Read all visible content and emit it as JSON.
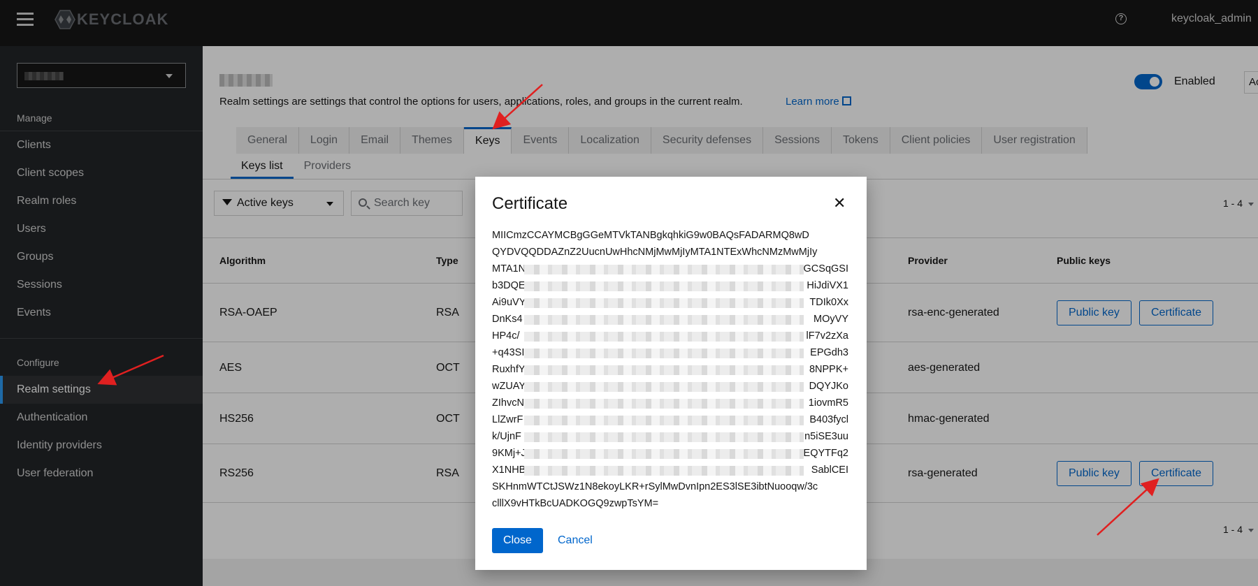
{
  "masthead": {
    "brand": "KEYCLOAK",
    "help": "?",
    "user": "keycloak_admin"
  },
  "sidebar": {
    "manage_label": "Manage",
    "manage_items": [
      {
        "label": "Clients"
      },
      {
        "label": "Client scopes"
      },
      {
        "label": "Realm roles"
      },
      {
        "label": "Users"
      },
      {
        "label": "Groups"
      },
      {
        "label": "Sessions"
      },
      {
        "label": "Events"
      }
    ],
    "configure_label": "Configure",
    "configure_items": [
      {
        "label": "Realm settings",
        "active": true
      },
      {
        "label": "Authentication"
      },
      {
        "label": "Identity providers"
      },
      {
        "label": "User federation"
      }
    ]
  },
  "header": {
    "description": "Realm settings are settings that control the options for users, applications, roles, and groups in the current realm.",
    "learn_more": "Learn more",
    "enabled_label": "Enabled",
    "enabled": true,
    "action_label": "Action"
  },
  "tabs": [
    {
      "label": "General"
    },
    {
      "label": "Login"
    },
    {
      "label": "Email"
    },
    {
      "label": "Themes"
    },
    {
      "label": "Keys",
      "active": true
    },
    {
      "label": "Events"
    },
    {
      "label": "Localization"
    },
    {
      "label": "Security defenses"
    },
    {
      "label": "Sessions"
    },
    {
      "label": "Tokens"
    },
    {
      "label": "Client policies"
    },
    {
      "label": "User registration"
    }
  ],
  "subtabs": [
    {
      "label": "Keys list",
      "active": true
    },
    {
      "label": "Providers"
    }
  ],
  "toolbar": {
    "filter": "Active keys",
    "search_placeholder": "Search key",
    "pagination": "1 - 4"
  },
  "table": {
    "headers": [
      "Algorithm",
      "Type",
      "Provider",
      "Public keys"
    ],
    "rows": [
      {
        "algorithm": "RSA-OAEP",
        "type": "RSA",
        "provider": "rsa-enc-generated",
        "public_key_btn": "Public key",
        "cert_btn": "Certificate"
      },
      {
        "algorithm": "AES",
        "type": "OCT",
        "provider": "aes-generated"
      },
      {
        "algorithm": "HS256",
        "type": "OCT",
        "provider": "hmac-generated"
      },
      {
        "algorithm": "RS256",
        "type": "RSA",
        "provider": "rsa-generated",
        "public_key_btn": "Public key",
        "cert_btn": "Certificate"
      }
    ]
  },
  "modal": {
    "title": "Certificate",
    "close_icon": "close-icon",
    "lines": [
      {
        "text": "MIICmzCCAYMCBgGGeMTVkTANBgkqhkiG9w0BAQsFADARMQ8wD"
      },
      {
        "text": "QYDVQQDDAZnZ2UucnUwHhcNMjMwMjIyMTA1NTExWhcNMzMwMjIy"
      },
      {
        "left": "MTA1N",
        "right": "GCSqGSI"
      },
      {
        "left": "b3DQE",
        "right": "HiJdiVX1"
      },
      {
        "left": "Ai9uVY",
        "right": "TDIk0Xx"
      },
      {
        "left": "DnKs4",
        "right": "MOyVY"
      },
      {
        "left": "HP4c/",
        "right": "lF7v2zXa"
      },
      {
        "left": "+q43SI",
        "right": "EPGdh3"
      },
      {
        "left": "RuxhfY",
        "right": "8NPPK+"
      },
      {
        "left": "wZUAY",
        "right": "DQYJKo"
      },
      {
        "left": "ZIhvcN",
        "right": "1iovmR5"
      },
      {
        "left": "LlZwrF",
        "right": "B403fycl"
      },
      {
        "left": "k/UjnF",
        "right": "n5iSE3uu"
      },
      {
        "left": "9KMj+J",
        "right": "EQYTFq2"
      },
      {
        "left": "X1NHB",
        "right": "SablCEI"
      },
      {
        "text": "SKHnmWTCtJSWz1N8ekoyLKR+rSylMwDvnIpn2ES3lSE3ibtNuooqw/3c"
      },
      {
        "text": "clllX9vHTkBcUADKOGQ9zwpTsYM="
      }
    ],
    "close_button": "Close",
    "cancel_button": "Cancel"
  },
  "colors": {
    "accent": "#0066cc",
    "masthead": "#151515",
    "sidebar": "#212427",
    "annotation_arrow": "#e02020"
  }
}
